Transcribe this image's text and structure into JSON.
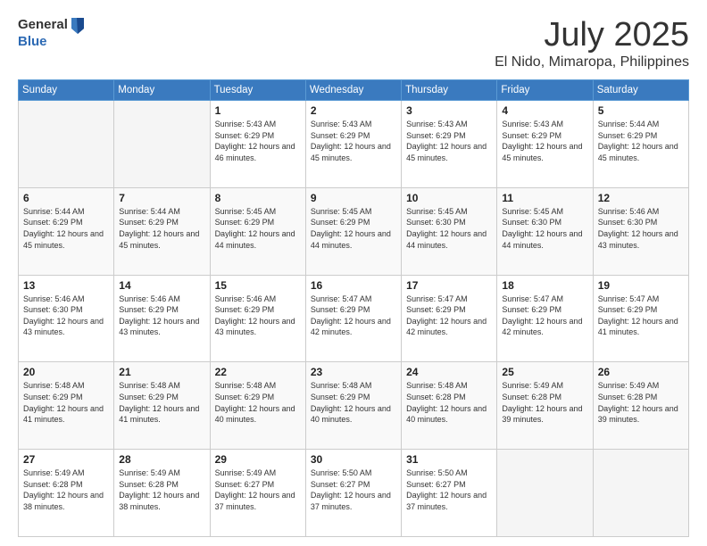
{
  "logo": {
    "line1": "General",
    "line2": "Blue"
  },
  "title": "July 2025",
  "subtitle": "El Nido, Mimaropa, Philippines",
  "days_of_week": [
    "Sunday",
    "Monday",
    "Tuesday",
    "Wednesday",
    "Thursday",
    "Friday",
    "Saturday"
  ],
  "weeks": [
    [
      {
        "day": "",
        "info": "",
        "empty": true
      },
      {
        "day": "",
        "info": "",
        "empty": true
      },
      {
        "day": "1",
        "info": "Sunrise: 5:43 AM\nSunset: 6:29 PM\nDaylight: 12 hours and 46 minutes.",
        "empty": false
      },
      {
        "day": "2",
        "info": "Sunrise: 5:43 AM\nSunset: 6:29 PM\nDaylight: 12 hours and 45 minutes.",
        "empty": false
      },
      {
        "day": "3",
        "info": "Sunrise: 5:43 AM\nSunset: 6:29 PM\nDaylight: 12 hours and 45 minutes.",
        "empty": false
      },
      {
        "day": "4",
        "info": "Sunrise: 5:43 AM\nSunset: 6:29 PM\nDaylight: 12 hours and 45 minutes.",
        "empty": false
      },
      {
        "day": "5",
        "info": "Sunrise: 5:44 AM\nSunset: 6:29 PM\nDaylight: 12 hours and 45 minutes.",
        "empty": false
      }
    ],
    [
      {
        "day": "6",
        "info": "Sunrise: 5:44 AM\nSunset: 6:29 PM\nDaylight: 12 hours and 45 minutes.",
        "empty": false
      },
      {
        "day": "7",
        "info": "Sunrise: 5:44 AM\nSunset: 6:29 PM\nDaylight: 12 hours and 45 minutes.",
        "empty": false
      },
      {
        "day": "8",
        "info": "Sunrise: 5:45 AM\nSunset: 6:29 PM\nDaylight: 12 hours and 44 minutes.",
        "empty": false
      },
      {
        "day": "9",
        "info": "Sunrise: 5:45 AM\nSunset: 6:29 PM\nDaylight: 12 hours and 44 minutes.",
        "empty": false
      },
      {
        "day": "10",
        "info": "Sunrise: 5:45 AM\nSunset: 6:30 PM\nDaylight: 12 hours and 44 minutes.",
        "empty": false
      },
      {
        "day": "11",
        "info": "Sunrise: 5:45 AM\nSunset: 6:30 PM\nDaylight: 12 hours and 44 minutes.",
        "empty": false
      },
      {
        "day": "12",
        "info": "Sunrise: 5:46 AM\nSunset: 6:30 PM\nDaylight: 12 hours and 43 minutes.",
        "empty": false
      }
    ],
    [
      {
        "day": "13",
        "info": "Sunrise: 5:46 AM\nSunset: 6:30 PM\nDaylight: 12 hours and 43 minutes.",
        "empty": false
      },
      {
        "day": "14",
        "info": "Sunrise: 5:46 AM\nSunset: 6:29 PM\nDaylight: 12 hours and 43 minutes.",
        "empty": false
      },
      {
        "day": "15",
        "info": "Sunrise: 5:46 AM\nSunset: 6:29 PM\nDaylight: 12 hours and 43 minutes.",
        "empty": false
      },
      {
        "day": "16",
        "info": "Sunrise: 5:47 AM\nSunset: 6:29 PM\nDaylight: 12 hours and 42 minutes.",
        "empty": false
      },
      {
        "day": "17",
        "info": "Sunrise: 5:47 AM\nSunset: 6:29 PM\nDaylight: 12 hours and 42 minutes.",
        "empty": false
      },
      {
        "day": "18",
        "info": "Sunrise: 5:47 AM\nSunset: 6:29 PM\nDaylight: 12 hours and 42 minutes.",
        "empty": false
      },
      {
        "day": "19",
        "info": "Sunrise: 5:47 AM\nSunset: 6:29 PM\nDaylight: 12 hours and 41 minutes.",
        "empty": false
      }
    ],
    [
      {
        "day": "20",
        "info": "Sunrise: 5:48 AM\nSunset: 6:29 PM\nDaylight: 12 hours and 41 minutes.",
        "empty": false
      },
      {
        "day": "21",
        "info": "Sunrise: 5:48 AM\nSunset: 6:29 PM\nDaylight: 12 hours and 41 minutes.",
        "empty": false
      },
      {
        "day": "22",
        "info": "Sunrise: 5:48 AM\nSunset: 6:29 PM\nDaylight: 12 hours and 40 minutes.",
        "empty": false
      },
      {
        "day": "23",
        "info": "Sunrise: 5:48 AM\nSunset: 6:29 PM\nDaylight: 12 hours and 40 minutes.",
        "empty": false
      },
      {
        "day": "24",
        "info": "Sunrise: 5:48 AM\nSunset: 6:28 PM\nDaylight: 12 hours and 40 minutes.",
        "empty": false
      },
      {
        "day": "25",
        "info": "Sunrise: 5:49 AM\nSunset: 6:28 PM\nDaylight: 12 hours and 39 minutes.",
        "empty": false
      },
      {
        "day": "26",
        "info": "Sunrise: 5:49 AM\nSunset: 6:28 PM\nDaylight: 12 hours and 39 minutes.",
        "empty": false
      }
    ],
    [
      {
        "day": "27",
        "info": "Sunrise: 5:49 AM\nSunset: 6:28 PM\nDaylight: 12 hours and 38 minutes.",
        "empty": false
      },
      {
        "day": "28",
        "info": "Sunrise: 5:49 AM\nSunset: 6:28 PM\nDaylight: 12 hours and 38 minutes.",
        "empty": false
      },
      {
        "day": "29",
        "info": "Sunrise: 5:49 AM\nSunset: 6:27 PM\nDaylight: 12 hours and 37 minutes.",
        "empty": false
      },
      {
        "day": "30",
        "info": "Sunrise: 5:50 AM\nSunset: 6:27 PM\nDaylight: 12 hours and 37 minutes.",
        "empty": false
      },
      {
        "day": "31",
        "info": "Sunrise: 5:50 AM\nSunset: 6:27 PM\nDaylight: 12 hours and 37 minutes.",
        "empty": false
      },
      {
        "day": "",
        "info": "",
        "empty": true
      },
      {
        "day": "",
        "info": "",
        "empty": true
      }
    ]
  ]
}
